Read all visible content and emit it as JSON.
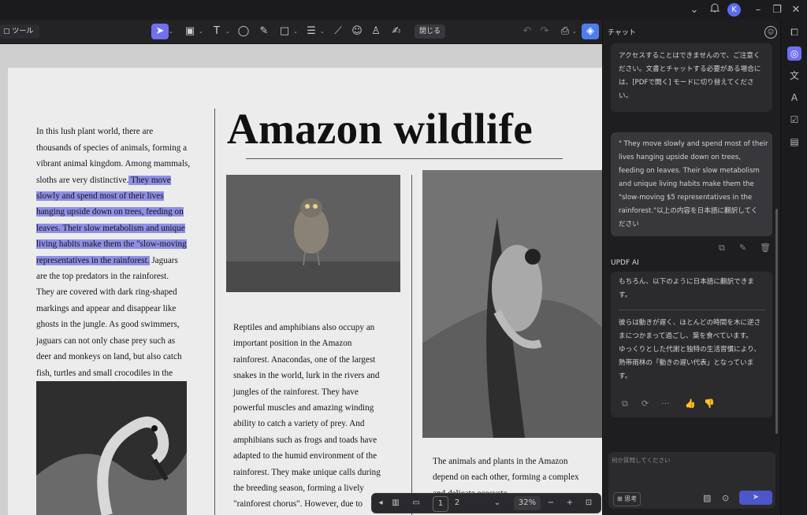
{
  "titlebar": {
    "avatar_letter": "K",
    "icons": [
      "chevron-down-icon",
      "bell-icon",
      "minimize-icon",
      "restore-icon",
      "close-icon"
    ]
  },
  "toolbar": {
    "tools_label": "ツール",
    "close_label": "閉じる"
  },
  "document": {
    "left_column_before": "In this lush plant world, there are\nthousands of species of animals, forming a\nvibrant animal kingdom. Among mammals,\nsloths are very distinctive.",
    "left_highlight": [
      " They move",
      "slowly and spend most of their lives",
      "hanging upside down on trees, feeding on",
      "leaves. Their slow metabolism and unique",
      "living habits make them the \"slow-moving",
      "representatives in the rainforest."
    ],
    "left_column_after_first": " Jaguars",
    "left_column_after": "are the top predators in the rainforest.\nThey are covered with dark ring-shaped\nmarkings and appear and disappear like\nghosts in the jungle. As good swimmers,\njaguars can not only chase prey such as\ndeer and monkeys on land, but also catch\nfish, turtles and small crocodiles in the\nwater.",
    "title": "Amazon wildlife",
    "middle_column": "Reptiles and amphibians also occupy an\nimportant position in the Amazon\nrainforest. Anacondas, one of the largest\nsnakes in the world, lurk in the rivers and\njungles of the rainforest. They have\npowerful muscles and amazing winding\nability to catch a variety of prey. And\namphibians such as frogs and toads have\nadapted to the humid environment of the\nrainforest. They make unique calls during\nthe breeding season, forming a lively\n\"rainforest chorus\". However, due to",
    "right_column": "The animals and plants in the Amazon\ndepend on each other, forming a complex\nand delicate ecosyste"
  },
  "pagebar": {
    "page1": "1",
    "page2": "2",
    "zoom": "32%"
  },
  "chat": {
    "title": "チャット",
    "prev_message": "アクセスすることはできませんので、ご注意く\nださい。文書とチャットする必要がある場合に\nは、[PDFで開く] モードに切り替えてくださ\nい。",
    "user_message": "\" They move slowly and spend most of their\nlives hanging upside down on trees,\nfeeding on leaves. Their slow metabolism\nand unique living habits make them the\n\"slow-moving $5 representatives in the\nrainforest.\"以上の内容を日本語に翻訳してく\nださい",
    "ai_label": "UPDF AI",
    "ai_intro": "もちろん、以下のように日本語に翻訳できま\nす。",
    "ai_translation": "彼らは動きが遅く、ほとんどの時間を木に逆さ\nまにつかまって過ごし、葉を食べています。\nゆっくりとした代謝と独特の生活習慣により、\n熱帯雨林の「動きの遅い代表」となっていま\nす。",
    "input_placeholder": "何か質問してください",
    "think_label": "思考"
  }
}
